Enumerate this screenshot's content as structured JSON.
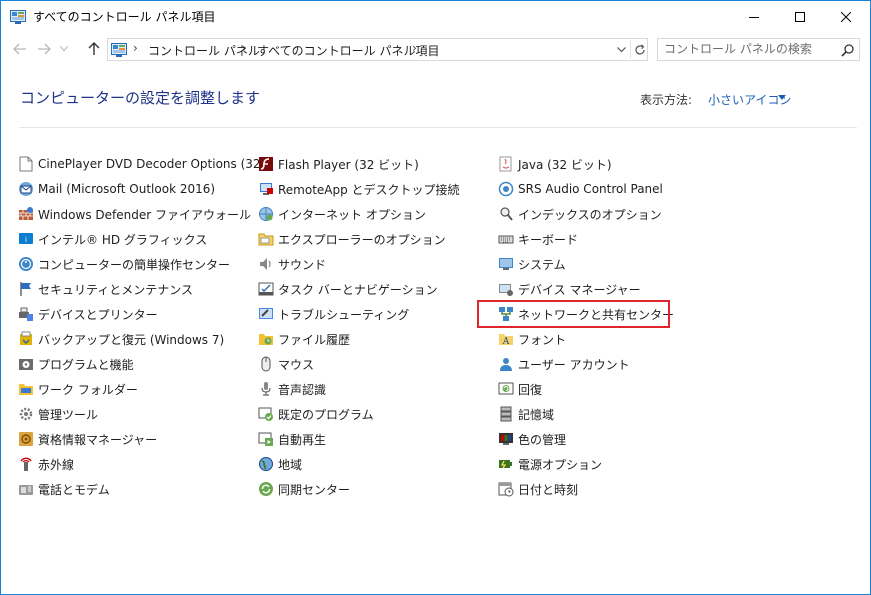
{
  "window": {
    "title": "すべてのコントロール パネル項目"
  },
  "address": {
    "breadcrumbs": [
      "コントロール パネル",
      "すべてのコントロール パネル項目"
    ]
  },
  "search": {
    "placeholder": "コントロール パネルの検索"
  },
  "header": {
    "title": "コンピューターの設定を調整します",
    "view_by_label": "表示方法:",
    "view_by_value": "小さいアイコン"
  },
  "columns": [
    {
      "items": [
        {
          "label": "CinePlayer DVD Decoder Options (32...",
          "icon": "dvd-document-icon"
        },
        {
          "label": "Mail (Microsoft Outlook 2016)",
          "icon": "mail-icon"
        },
        {
          "label": "Windows Defender ファイアウォール",
          "icon": "firewall-icon"
        },
        {
          "label": "インテル® HD グラフィックス",
          "icon": "intel-graphics-icon"
        },
        {
          "label": "コンピューターの簡単操作センター",
          "icon": "ease-of-access-icon"
        },
        {
          "label": "セキュリティとメンテナンス",
          "icon": "flag-icon"
        },
        {
          "label": "デバイスとプリンター",
          "icon": "printer-icon"
        },
        {
          "label": "バックアップと復元 (Windows 7)",
          "icon": "backup-icon"
        },
        {
          "label": "プログラムと機能",
          "icon": "programs-icon"
        },
        {
          "label": "ワーク フォルダー",
          "icon": "work-folders-icon"
        },
        {
          "label": "管理ツール",
          "icon": "admin-tools-icon"
        },
        {
          "label": "資格情報マネージャー",
          "icon": "credential-icon"
        },
        {
          "label": "赤外線",
          "icon": "infrared-icon"
        },
        {
          "label": "電話とモデム",
          "icon": "phone-modem-icon"
        }
      ]
    },
    {
      "items": [
        {
          "label": "Flash Player (32 ビット)",
          "icon": "flash-icon"
        },
        {
          "label": "RemoteApp とデスクトップ接続",
          "icon": "remoteapp-icon"
        },
        {
          "label": "インターネット オプション",
          "icon": "internet-options-icon"
        },
        {
          "label": "エクスプローラーのオプション",
          "icon": "folder-options-icon"
        },
        {
          "label": "サウンド",
          "icon": "speaker-icon"
        },
        {
          "label": "タスク バーとナビゲーション",
          "icon": "taskbar-icon"
        },
        {
          "label": "トラブルシューティング",
          "icon": "troubleshoot-icon"
        },
        {
          "label": "ファイル履歴",
          "icon": "file-history-icon"
        },
        {
          "label": "マウス",
          "icon": "mouse-icon"
        },
        {
          "label": "音声認識",
          "icon": "microphone-icon"
        },
        {
          "label": "既定のプログラム",
          "icon": "default-programs-icon"
        },
        {
          "label": "自動再生",
          "icon": "autoplay-icon"
        },
        {
          "label": "地域",
          "icon": "globe-icon"
        },
        {
          "label": "同期センター",
          "icon": "sync-icon"
        }
      ]
    },
    {
      "items": [
        {
          "label": "Java (32 ビット)",
          "icon": "java-icon"
        },
        {
          "label": "SRS Audio Control Panel",
          "icon": "srs-audio-icon"
        },
        {
          "label": "インデックスのオプション",
          "icon": "indexing-icon"
        },
        {
          "label": "キーボード",
          "icon": "keyboard-icon"
        },
        {
          "label": "システム",
          "icon": "system-icon"
        },
        {
          "label": "デバイス マネージャー",
          "icon": "device-manager-icon"
        },
        {
          "label": "ネットワークと共有センター",
          "icon": "network-icon"
        },
        {
          "label": "フォント",
          "icon": "fonts-icon"
        },
        {
          "label": "ユーザー アカウント",
          "icon": "user-accounts-icon"
        },
        {
          "label": "回復",
          "icon": "recovery-icon"
        },
        {
          "label": "記憶域",
          "icon": "storage-icon"
        },
        {
          "label": "色の管理",
          "icon": "color-management-icon"
        },
        {
          "label": "電源オプション",
          "icon": "power-icon"
        },
        {
          "label": "日付と時刻",
          "icon": "calendar-clock-icon"
        }
      ]
    }
  ],
  "highlighted_item": "ネットワークと共有センター",
  "colors": {
    "accent": "#1a5fb4",
    "title": "#1e3287",
    "highlight": "#e0262a",
    "window_border": "#1883d7"
  }
}
